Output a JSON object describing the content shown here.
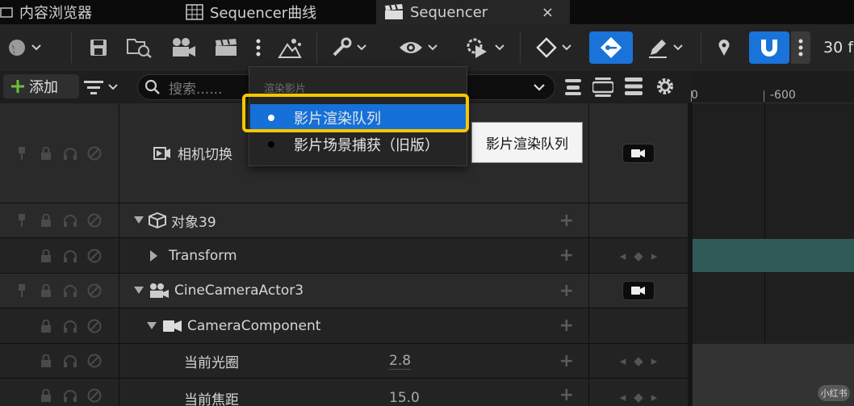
{
  "tabs": [
    {
      "label": "内容浏览器",
      "icon": "folder-icon"
    },
    {
      "label": "Sequencer曲线",
      "icon": "curve-grid-icon"
    },
    {
      "label": "Sequencer",
      "icon": "clapperboard-icon",
      "close": "×"
    }
  ],
  "toolbar": {
    "frame_rate": "30 f"
  },
  "row2": {
    "add_label": "添加",
    "search_placeholder": "搜索......"
  },
  "timeline": {
    "ticks": [
      "0",
      "-600"
    ]
  },
  "menu": {
    "header": "渲染影片",
    "items": [
      {
        "label": "影片渲染队列",
        "selected": true
      },
      {
        "label": "影片场景捕获（旧版）",
        "selected": false
      }
    ]
  },
  "tooltip": "影片渲染队列",
  "tracks": [
    {
      "name": "相机切换"
    },
    {
      "name": "对象39"
    },
    {
      "name": "Transform"
    },
    {
      "name": "CineCameraActor3"
    },
    {
      "name": "CameraComponent"
    },
    {
      "name": "当前光圈",
      "value": "2.8"
    },
    {
      "name": "当前焦距",
      "value": "15.0"
    }
  ],
  "watermark": "小红书",
  "colors": {
    "accent": "#1a73d9",
    "highlight": "#f7c600",
    "track_teal": "#2f5a58"
  }
}
